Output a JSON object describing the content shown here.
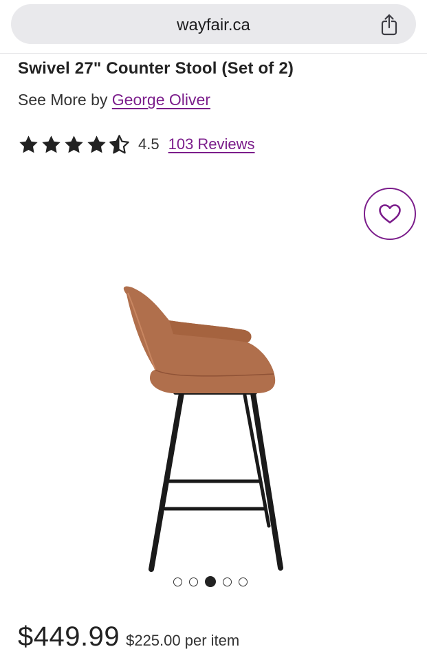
{
  "browser": {
    "url": "wayfair.ca",
    "share_icon": "share-icon"
  },
  "product": {
    "title": "Swivel 27\" Counter Stool (Set of 2)",
    "brand_prefix": "See More by",
    "brand_name": "George Oliver",
    "rating": 4.5,
    "rating_text": "4.5",
    "reviews_text": "103 Reviews",
    "favorite_icon": "heart-icon",
    "image_icon": "bar-stool-image",
    "carousel": {
      "count": 5,
      "active_index": 3
    },
    "price": "$449.99",
    "per_item": "$225.00 per item"
  },
  "colors": {
    "brand_purple": "#7b1d8b",
    "text_dark": "#222222",
    "url_bar": "#e9e9ec",
    "leather": "#b06f4c",
    "legs": "#1a1a1a"
  }
}
